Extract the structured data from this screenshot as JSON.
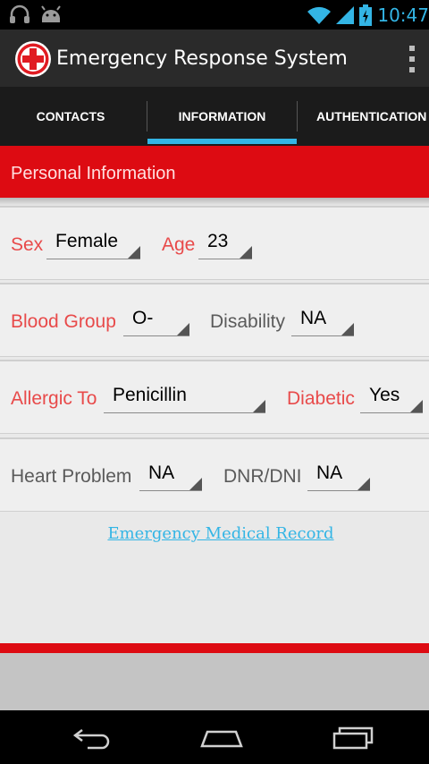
{
  "status_bar": {
    "time": "10:47",
    "left_icons": [
      "headphones-icon",
      "android-icon"
    ],
    "right_icons": [
      "wifi-icon",
      "signal-icon",
      "battery-charging-icon"
    ]
  },
  "app": {
    "title": "Emergency Response System",
    "logo_icon": "red-cross-icon"
  },
  "tabs": [
    {
      "label": "CONTACTS",
      "selected": false
    },
    {
      "label": "INFORMATION",
      "selected": true
    },
    {
      "label": "AUTHENTICATION",
      "selected": false
    }
  ],
  "section": {
    "title": "Personal Information"
  },
  "fields": {
    "sex": {
      "label": "Sex",
      "value": "Female"
    },
    "age": {
      "label": "Age",
      "value": "23"
    },
    "blood_group": {
      "label": "Blood Group",
      "value": "O-"
    },
    "disability": {
      "label": "Disability",
      "value": "NA"
    },
    "allergic_to": {
      "label": "Allergic To",
      "value": "Penicillin"
    },
    "diabetic": {
      "label": "Diabetic",
      "value": "Yes"
    },
    "heart_problem": {
      "label": "Heart Problem",
      "value": "NA"
    },
    "dnr_dni": {
      "label": "DNR/DNI",
      "value": "NA"
    }
  },
  "link": {
    "label": "Emergency Medical Record"
  },
  "colors": {
    "accent": "#33b5e5",
    "header_red": "#dd0b12",
    "label_red": "#e84a4a",
    "label_gray": "#5a5a5a"
  },
  "nav": [
    "back-icon",
    "home-icon",
    "recent-apps-icon"
  ]
}
